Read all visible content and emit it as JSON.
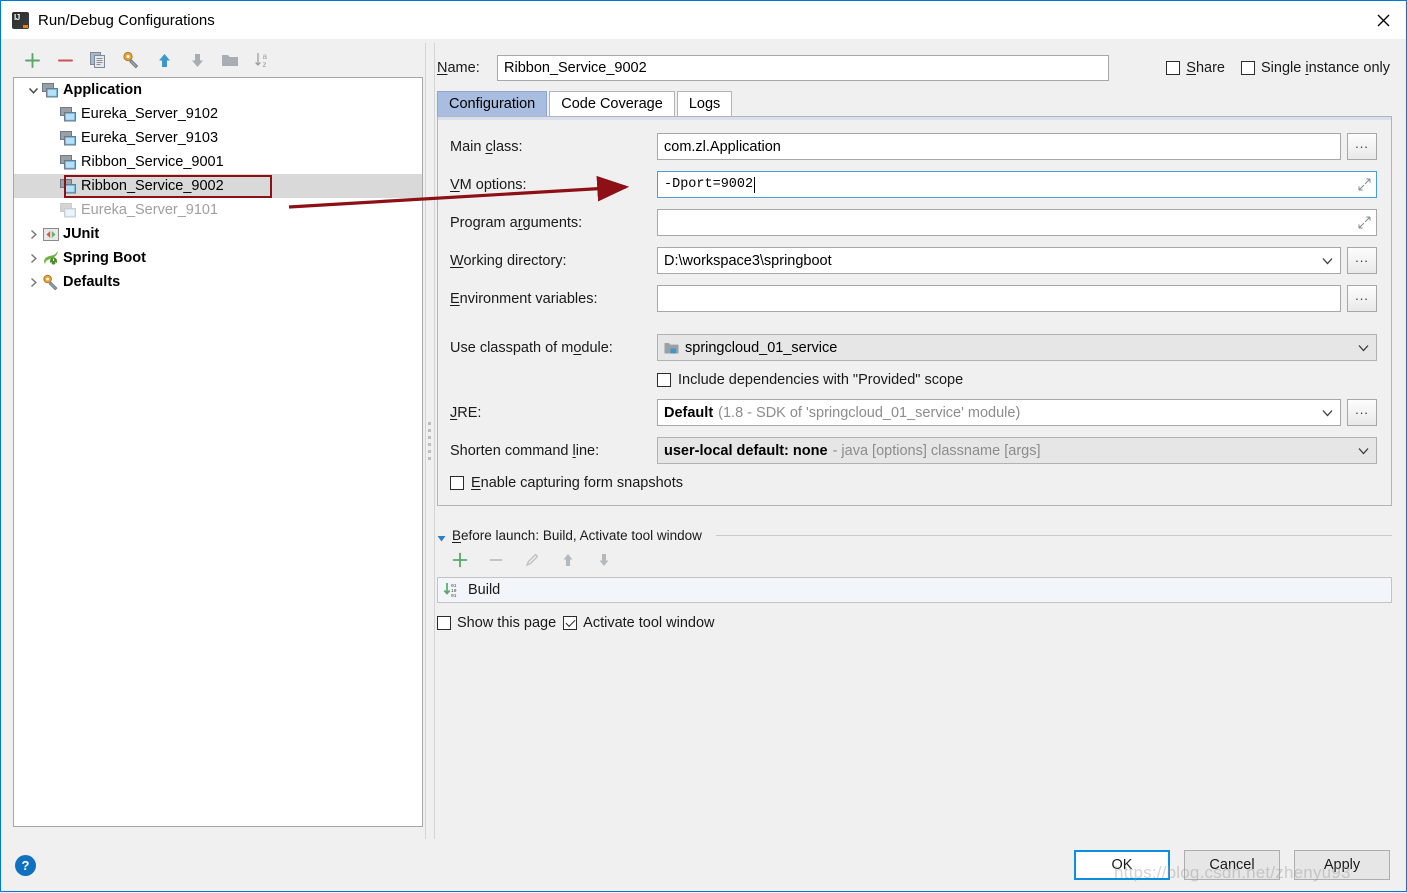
{
  "window": {
    "title": "Run/Debug Configurations",
    "app_icon": "intellij-idea-icon",
    "close_icon": "close-icon"
  },
  "tree_toolbar": {
    "buttons": [
      {
        "name": "add-configuration-button",
        "icon": "plus-icon",
        "label": "+"
      },
      {
        "name": "remove-configuration-button",
        "icon": "minus-icon",
        "label": "−"
      },
      {
        "name": "copy-configuration-button",
        "icon": "copy-icon",
        "label": "Copy"
      },
      {
        "name": "edit-templates-button",
        "icon": "wrench-gear-icon",
        "label": "Edit Templates"
      },
      {
        "name": "move-up-button",
        "icon": "arrow-up-icon",
        "label": "Move Up"
      },
      {
        "name": "move-down-button",
        "icon": "arrow-down-icon",
        "label": "Move Down"
      },
      {
        "name": "new-folder-button",
        "icon": "folder-icon",
        "label": "New Folder"
      },
      {
        "name": "sort-configurations-button",
        "icon": "sort-az-icon",
        "label": "Sort Configurations"
      }
    ]
  },
  "tree": {
    "items": [
      {
        "label": "Application",
        "icon": "application-icon",
        "level": 0,
        "expanded": true,
        "bold": true,
        "dim": false,
        "selected": false
      },
      {
        "label": "Eureka_Server_9102",
        "icon": "application-icon",
        "level": 1,
        "expanded": null,
        "bold": false,
        "dim": false,
        "selected": false
      },
      {
        "label": "Eureka_Server_9103",
        "icon": "application-icon",
        "level": 1,
        "expanded": null,
        "bold": false,
        "dim": false,
        "selected": false
      },
      {
        "label": "Ribbon_Service_9001",
        "icon": "application-icon",
        "level": 1,
        "expanded": null,
        "bold": false,
        "dim": false,
        "selected": false
      },
      {
        "label": "Ribbon_Service_9002",
        "icon": "application-icon",
        "level": 1,
        "expanded": null,
        "bold": false,
        "dim": false,
        "selected": true
      },
      {
        "label": "Eureka_Server_9101",
        "icon": "application-icon",
        "level": 1,
        "expanded": null,
        "bold": false,
        "dim": true,
        "selected": false
      },
      {
        "label": "JUnit",
        "icon": "junit-icon",
        "level": 0,
        "expanded": false,
        "bold": true,
        "dim": false,
        "selected": false
      },
      {
        "label": "Spring Boot",
        "icon": "spring-boot-icon",
        "level": 0,
        "expanded": false,
        "bold": true,
        "dim": false,
        "selected": false
      },
      {
        "label": "Defaults",
        "icon": "wrench-gear-icon",
        "level": 0,
        "expanded": false,
        "bold": true,
        "dim": false,
        "selected": false
      }
    ]
  },
  "name_row": {
    "label": "Name:",
    "value": "Ribbon_Service_9002",
    "placeholder": "",
    "share": {
      "label": "Share",
      "checked": false
    },
    "single_instance": {
      "label": "Single instance only",
      "checked": false
    }
  },
  "tabs": [
    {
      "label": "Configuration",
      "active": true
    },
    {
      "label": "Code Coverage",
      "active": false
    },
    {
      "label": "Logs",
      "active": false
    }
  ],
  "configuration": {
    "main_class": {
      "label": "Main class:",
      "value": "com.zl.Application",
      "browse_label": "..."
    },
    "vm_options": {
      "label": "VM options:",
      "value": "-Dport=9002",
      "focused": true,
      "expand_icon": "expand-editor-icon"
    },
    "program_arguments": {
      "label": "Program arguments:",
      "value": "",
      "expand_icon": "expand-editor-icon"
    },
    "working_directory": {
      "label": "Working directory:",
      "value": "D:\\workspace3\\springboot",
      "browse_label": "..."
    },
    "environment_variables": {
      "label": "Environment variables:",
      "value": "",
      "browse_label": "..."
    },
    "use_classpath_of_module": {
      "label": "Use classpath of module:",
      "value": "springcloud_01_service",
      "icon": "module-icon"
    },
    "include_provided": {
      "label": "Include dependencies with \"Provided\" scope",
      "checked": false
    },
    "jre": {
      "label": "JRE:",
      "value_strong": "Default",
      "value_muted": "(1.8 - SDK of 'springcloud_01_service' module)",
      "browse_label": "..."
    },
    "shorten_command_line": {
      "label": "Shorten command line:",
      "value_strong": "user-local default: none",
      "value_muted": "- java [options] classname [args]"
    },
    "enable_form_snapshots": {
      "label": "Enable capturing form snapshots",
      "checked": false
    }
  },
  "before_launch": {
    "header": "Before launch: Build, Activate tool window",
    "toolbar": [
      {
        "name": "add-task-button",
        "icon": "plus-icon",
        "enabled": true
      },
      {
        "name": "remove-task-button",
        "icon": "minus-icon",
        "enabled": false
      },
      {
        "name": "edit-task-button",
        "icon": "pencil-icon",
        "enabled": false
      },
      {
        "name": "task-move-up-button",
        "icon": "arrow-up-icon",
        "enabled": true
      },
      {
        "name": "task-move-down-button",
        "icon": "arrow-down-icon",
        "enabled": true
      }
    ],
    "tasks": [
      {
        "label": "Build",
        "icon": "build-icon"
      }
    ],
    "show_this_page": {
      "label": "Show this page",
      "checked": false
    },
    "activate_tool_window": {
      "label": "Activate tool window",
      "checked": true
    }
  },
  "footer": {
    "help_label": "?",
    "buttons": [
      {
        "label": "OK",
        "name": "ok-button",
        "default": true
      },
      {
        "label": "Cancel",
        "name": "cancel-button",
        "default": false
      },
      {
        "label": "Apply",
        "name": "apply-button",
        "default": false
      }
    ]
  },
  "annotation": {
    "arrow_color": "#8c1016",
    "highlight_box_color": "#8c1016"
  },
  "watermark": {
    "text": "https://blog.csdn.net/zhenyu93"
  }
}
